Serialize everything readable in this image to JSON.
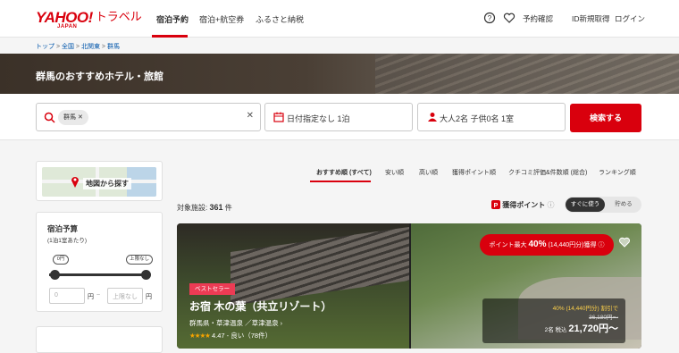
{
  "header": {
    "logo_yahoo": "YAHOO!",
    "logo_japan": "JAPAN",
    "logo_travel": "トラベル",
    "tabs": [
      {
        "label": "宿泊予約",
        "active": true
      },
      {
        "label": "宿泊+航空券",
        "active": false
      },
      {
        "label": "ふるさと納税",
        "active": false
      }
    ],
    "links": {
      "reservation": "予約確認",
      "signup": "ID新規取得",
      "login": "ログイン"
    },
    "icons": [
      "help-icon",
      "heart-icon"
    ]
  },
  "breadcrumb": [
    "トップ",
    "全国",
    "北関東",
    "群馬"
  ],
  "hero_title": "群馬のおすすめホテル・旅館",
  "search": {
    "area_chip": "群馬",
    "date_value": "日付指定なし 1泊",
    "guests_value": "大人2名 子供0名 1室",
    "submit_label": "検索する"
  },
  "sidebar": {
    "map_label": "地図から探す",
    "budget_title": "宿泊予算",
    "budget_sub": "(1泊1室あたり)",
    "min_pill": "0円",
    "max_pill": "上限なし",
    "min_input": "0",
    "max_input": "上限なし",
    "yen": "円",
    "tilde": "~"
  },
  "sort_tabs": [
    "おすすめ順 (すべて)",
    "安い順",
    "高い順",
    "獲得ポイント順",
    "クチコミ評価&件数順 (総合)",
    "ランキング順"
  ],
  "result": {
    "label": "対象施設:",
    "count": "361",
    "unit": "件"
  },
  "points": {
    "label": "獲得ポイント",
    "toggle_on": "すぐに使う",
    "toggle_off": "貯める"
  },
  "card": {
    "promo_prefix": "ポイント最大",
    "promo_pct": "40%",
    "promo_suffix": "(14,440円分)獲得",
    "badge": "ベストセラー",
    "name": "お宿 木の葉（共立リゾート）",
    "location": "群馬県・草津温泉 ／草津温泉 ›",
    "stars": "★★★★",
    "rating": "4.47 - 良い（78件）",
    "discount": "40% (14,440円分) 割引で",
    "original_price": "36,180円〜",
    "price_prefix": "2名 税込",
    "price": "21,720円〜"
  },
  "colors": {
    "accent": "#d9000d",
    "badge": "#ec3b54",
    "star": "#f5a300"
  }
}
